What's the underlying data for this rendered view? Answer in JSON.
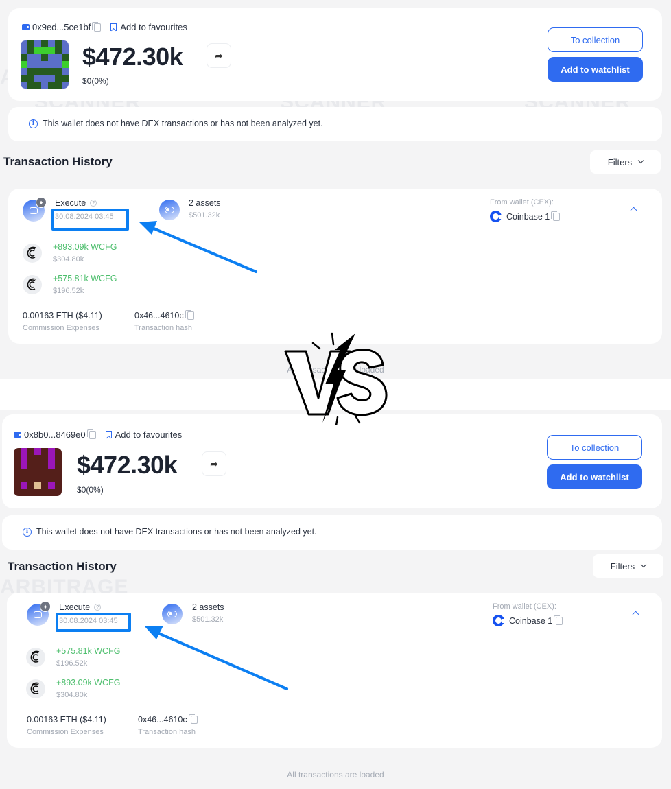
{
  "panels": [
    {
      "id": "a",
      "wallet": {
        "address": "0x9ed...5ce1bf",
        "favourites_label": "Add to favourites",
        "balance": "$472.30k",
        "change": "$0(0%)",
        "avatar": {
          "palette": [
            "#5b6fc8",
            "#265a1f",
            "#3ccf2e"
          ],
          "grid": [
            [
              0,
              1,
              0,
              1,
              0,
              1,
              0
            ],
            [
              0,
              1,
              2,
              2,
              2,
              1,
              0
            ],
            [
              1,
              0,
              0,
              1,
              0,
              0,
              1
            ],
            [
              2,
              0,
              0,
              0,
              0,
              0,
              2
            ],
            [
              0,
              1,
              1,
              1,
              1,
              1,
              0
            ],
            [
              1,
              1,
              0,
              0,
              0,
              1,
              1
            ],
            [
              0,
              1,
              1,
              0,
              1,
              1,
              0
            ]
          ]
        },
        "buttons": {
          "collection": "To collection",
          "watchlist": "Add to watchlist"
        }
      },
      "notice": "This wallet does not have DEX transactions or has not been analyzed yet.",
      "history_title": "Transaction History",
      "filters_label": "Filters",
      "transaction": {
        "type": "Execute",
        "help": "?",
        "datetime": "30.08.2024 03:45",
        "assets_count": "2 assets",
        "assets_value": "$501.32k",
        "from_label": "From wallet (CEX):",
        "from_wallet": "Coinbase 1",
        "tokens": [
          {
            "amount": "+893.09k WCFG",
            "value": "$304.80k"
          },
          {
            "amount": "+575.81k WCFG",
            "value": "$196.52k"
          }
        ],
        "fee": "0.00163 ETH ($4.11)",
        "fee_label": "Commission Expenses",
        "hash": "0x46...4610c",
        "hash_label": "Transaction hash"
      },
      "footer": "All transactions are loaded"
    },
    {
      "id": "b",
      "wallet": {
        "address": "0x8b0...8469e0",
        "favourites_label": "Add to favourites",
        "balance": "$472.30k",
        "change": "$0(0%)",
        "avatar": {
          "palette": [
            "#541f1a",
            "#9b16b8",
            "#e0bf93"
          ],
          "grid": [
            [
              0,
              1,
              0,
              1,
              0,
              1,
              0
            ],
            [
              0,
              1,
              0,
              0,
              0,
              1,
              0
            ],
            [
              0,
              1,
              0,
              0,
              0,
              1,
              0
            ],
            [
              0,
              0,
              0,
              0,
              0,
              0,
              0
            ],
            [
              0,
              0,
              0,
              0,
              0,
              0,
              0
            ],
            [
              0,
              1,
              0,
              2,
              0,
              1,
              0
            ],
            [
              0,
              0,
              0,
              0,
              0,
              0,
              0
            ]
          ]
        },
        "buttons": {
          "collection": "To collection",
          "watchlist": "Add to watchlist"
        }
      },
      "notice": "This wallet does not have DEX transactions or has not been analyzed yet.",
      "history_title": "Transaction History",
      "filters_label": "Filters",
      "transaction": {
        "type": "Execute",
        "help": "?",
        "datetime": "30.08.2024 03:45",
        "assets_count": "2 assets",
        "assets_value": "$501.32k",
        "from_label": "From wallet (CEX):",
        "from_wallet": "Coinbase 1",
        "tokens": [
          {
            "amount": "+575.81k WCFG",
            "value": "$196.52k"
          },
          {
            "amount": "+893.09k WCFG",
            "value": "$304.80k"
          }
        ],
        "fee": "0.00163 ETH ($4.11)",
        "fee_label": "Commission Expenses",
        "hash": "0x46...4610c",
        "hash_label": "Transaction hash"
      },
      "footer": "All transactions are loaded"
    }
  ],
  "watermark": {
    "line1": "ARBITRAGE",
    "line2": "SCANNER"
  },
  "overlay": {
    "vs_label": "VS",
    "annotation_color": "#0c7ff2"
  },
  "colors": {
    "accent": "#2f6bf0",
    "positive": "#4cbe6c",
    "muted": "#a5abb5",
    "highlight": "#0c7ff2"
  }
}
